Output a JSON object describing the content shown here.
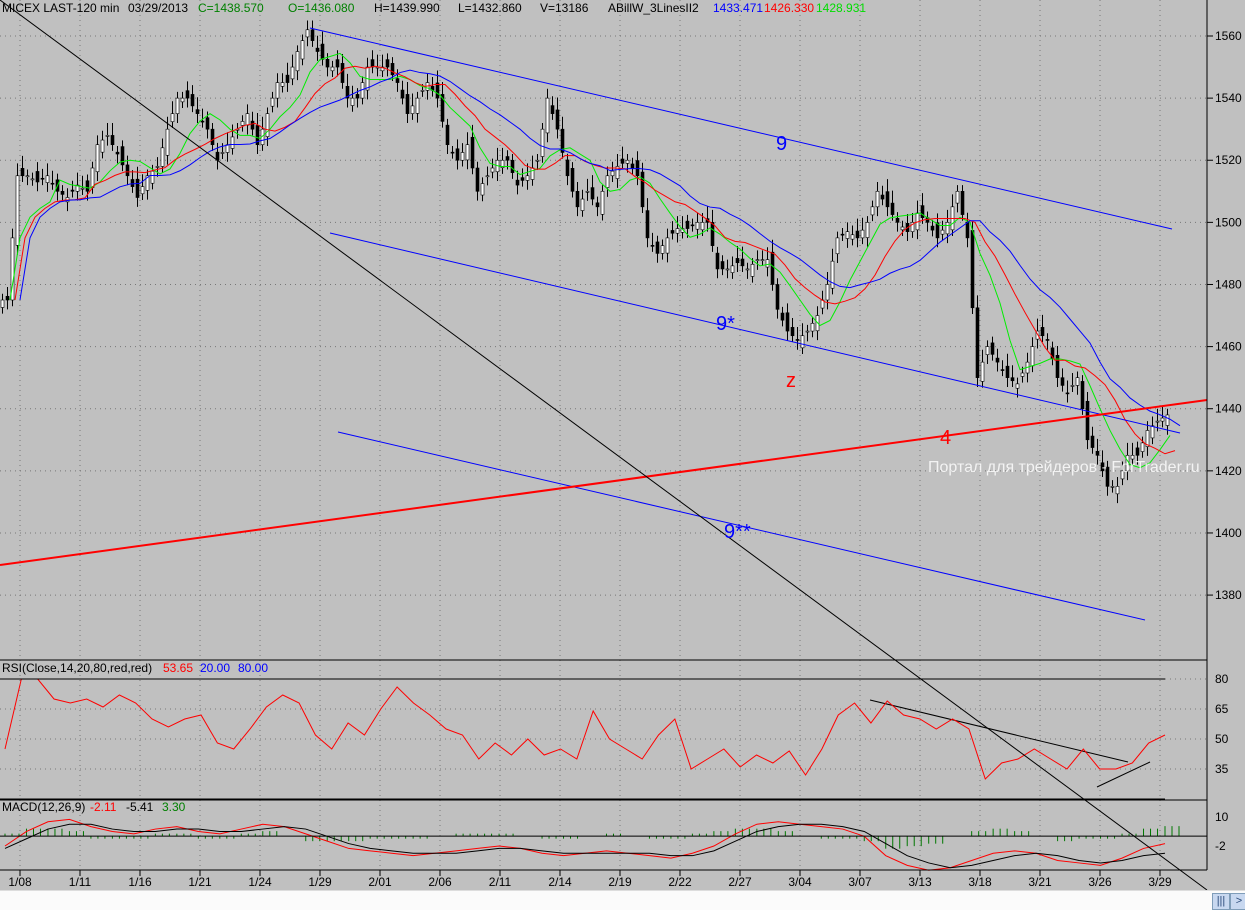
{
  "header": {
    "symbol": "MICEX LAST-120 min",
    "date": "03/29/2013",
    "close": "C=1438.570",
    "open": "O=1436.080",
    "high": "H=1439.990",
    "low": "L=1432.860",
    "volume": "V=13186",
    "indicator": "ABillW_3LinesII2",
    "ma_blue": "1433.471",
    "ma_red": "1426.330",
    "ma_green": "1428.931"
  },
  "rsi_header": {
    "name": "RSI(Close,14,20,80,red,red)",
    "value": "53.65",
    "low": "20.00",
    "high": "80.00"
  },
  "macd_header": {
    "name": "MACD(12,26,9)",
    "macd": "-2.11",
    "signal": "-5.41",
    "hist": "3.30"
  },
  "watermark": "Портал для трейдеров - ForTrader.ru",
  "annotations": {
    "upper": "9",
    "middle": "9*",
    "lower": "9**",
    "support": "4",
    "wave": "z"
  },
  "colors": {
    "bg": "#c0c0c0",
    "blue": "#0000ff",
    "red": "#ff0000",
    "green": "#00ee00",
    "macd_hist": "#007700"
  },
  "scroll": {
    "grip": "|||",
    "right": ">"
  },
  "chart_data": [
    {
      "type": "candlestick",
      "title": "MICEX LAST-120 min",
      "ylim": [
        1365,
        1570
      ],
      "price_ticks": [
        1380,
        1400,
        1420,
        1440,
        1460,
        1480,
        1500,
        1520,
        1540,
        1560
      ],
      "x_tick_labels": [
        "1/08",
        "1/11",
        "1/16",
        "1/21",
        "1/24",
        "1/29",
        "2/01",
        "2/06",
        "2/11",
        "2/14",
        "2/19",
        "2/22",
        "2/27",
        "3/04",
        "3/07",
        "3/13",
        "3/18",
        "3/21",
        "3/26",
        "3/29"
      ],
      "close_series": [
        1475,
        1515,
        1515,
        1513,
        1515,
        1510,
        1508,
        1512,
        1510,
        1525,
        1528,
        1522,
        1515,
        1508,
        1515,
        1518,
        1530,
        1540,
        1540,
        1535,
        1530,
        1520,
        1525,
        1530,
        1535,
        1525,
        1535,
        1545,
        1545,
        1555,
        1562,
        1555,
        1550,
        1550,
        1540,
        1540,
        1550,
        1550,
        1550,
        1545,
        1535,
        1540,
        1545,
        1540,
        1525,
        1520,
        1525,
        1510,
        1515,
        1520,
        1520,
        1512,
        1515,
        1520,
        1540,
        1530,
        1515,
        1505,
        1510,
        1505,
        1515,
        1518,
        1520,
        1515,
        1495,
        1490,
        1495,
        1498,
        1498,
        1500,
        1500,
        1485,
        1485,
        1487,
        1485,
        1488,
        1488,
        1472,
        1465,
        1462,
        1465,
        1470,
        1480,
        1495,
        1497,
        1495,
        1500,
        1510,
        1505,
        1500,
        1497,
        1503,
        1500,
        1495,
        1500,
        1510,
        1495,
        1450,
        1460,
        1455,
        1450,
        1448,
        1455,
        1465,
        1462,
        1450,
        1445,
        1450,
        1430,
        1425,
        1415,
        1415,
        1425,
        1425,
        1433,
        1436,
        1438
      ]
    },
    {
      "type": "line",
      "title": "RSI(Close,14,20,80,red,red)",
      "ylim": [
        20,
        80
      ],
      "y_ticks": [
        35,
        50,
        65,
        80
      ],
      "values": [
        45,
        80,
        80,
        70,
        68,
        70,
        66,
        72,
        68,
        60,
        56,
        60,
        62,
        48,
        45,
        55,
        66,
        72,
        68,
        52,
        45,
        58,
        52,
        65,
        76,
        68,
        62,
        55,
        52,
        40,
        48,
        42,
        50,
        42,
        45,
        40,
        64,
        50,
        45,
        40,
        52,
        60,
        35,
        40,
        45,
        36,
        42,
        38,
        44,
        32,
        45,
        62,
        68,
        58,
        69,
        62,
        60,
        55,
        60,
        55,
        30,
        38,
        40,
        45,
        40,
        35,
        45,
        35,
        35,
        38,
        48,
        52
      ]
    },
    {
      "type": "line",
      "title": "MACD(12,26,9)",
      "y_ticks": [
        10,
        -2
      ],
      "macd": [
        -2,
        4,
        8,
        9,
        6,
        4,
        3,
        5,
        6,
        4,
        3,
        5,
        7,
        6,
        3,
        0,
        -3,
        -4,
        -5,
        -6,
        -5,
        -4,
        -3,
        -2,
        -3,
        -5,
        -6,
        -5,
        -4,
        -5,
        -6,
        -7,
        -5,
        -2,
        3,
        7,
        8,
        7,
        6,
        5,
        2,
        -6,
        -10,
        -12,
        -11,
        -8,
        -5,
        -4,
        -5,
        -8,
        -9,
        -10,
        -7,
        -3,
        -1
      ],
      "signal": [
        -3,
        1,
        5,
        7,
        7,
        5,
        4,
        4,
        5,
        5,
        4,
        4,
        5,
        6,
        5,
        2,
        -1,
        -3,
        -4,
        -5,
        -5,
        -5,
        -4,
        -3,
        -3,
        -4,
        -5,
        -5,
        -5,
        -5,
        -5,
        -6,
        -6,
        -4,
        0,
        4,
        6,
        7,
        7,
        6,
        4,
        -1,
        -6,
        -9,
        -11,
        -10,
        -8,
        -6,
        -5,
        -6,
        -8,
        -9,
        -8,
        -6,
        -5
      ]
    }
  ]
}
